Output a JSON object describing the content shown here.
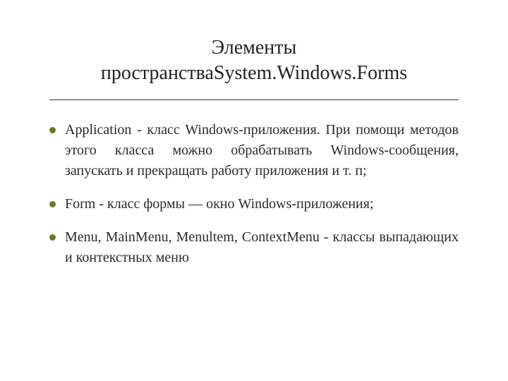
{
  "title_line1": "Элементы",
  "title_line2": "пространстваSystem.Windows.Forms",
  "bullets": [
    "Application - класс Windows-приложения. При помощи методов этого класса можно обрабатывать Windows-сообщения, запускать и прекращать работу приложения и т. п;",
    "Form - класс формы — окно Windows-приложения;",
    "Menu, MainMenu, Menultem, ContextMenu - классы выпадающих и контекстных меню"
  ]
}
